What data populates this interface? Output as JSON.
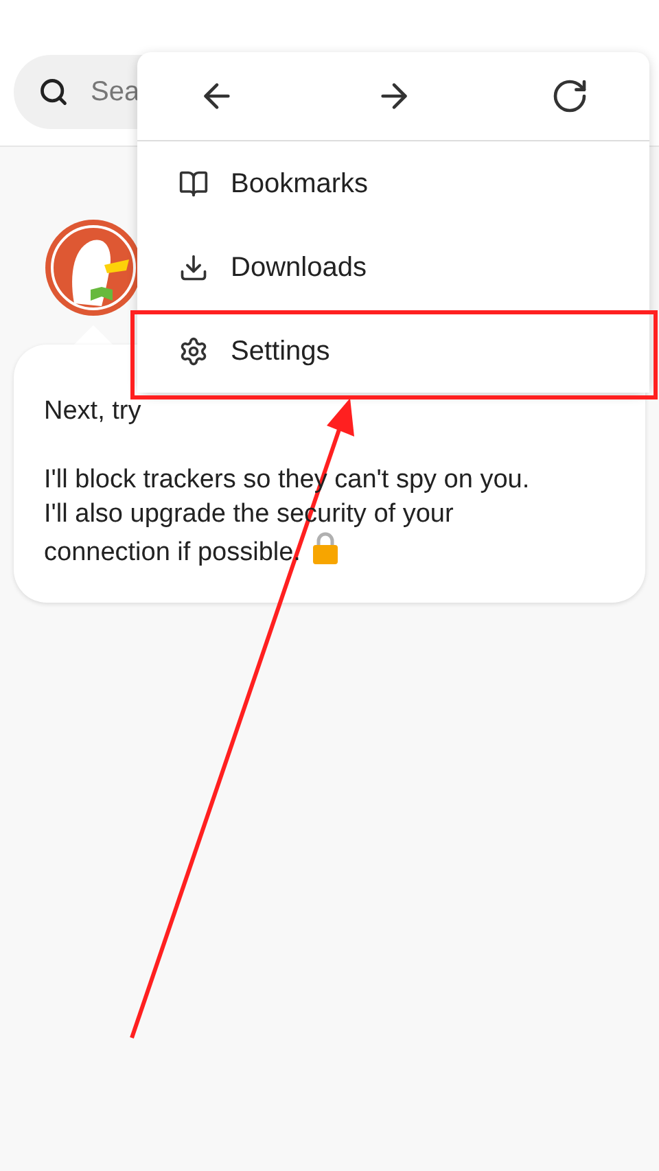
{
  "search": {
    "placeholder": "Sea"
  },
  "menu": {
    "nav": [
      {
        "kind": "back"
      },
      {
        "kind": "forward"
      },
      {
        "kind": "reload"
      }
    ],
    "items": [
      {
        "kind": "bookmarks",
        "label": "Bookmarks",
        "selected": false
      },
      {
        "kind": "downloads",
        "label": "Downloads",
        "selected": false
      },
      {
        "kind": "settings",
        "label": "Settings",
        "selected": true
      }
    ]
  },
  "bubble": {
    "lines": [
      "Next, try",
      "I'll block trackers so they can't spy on you.",
      "I'll also upgrade the security of your",
      "connection if possible."
    ]
  }
}
